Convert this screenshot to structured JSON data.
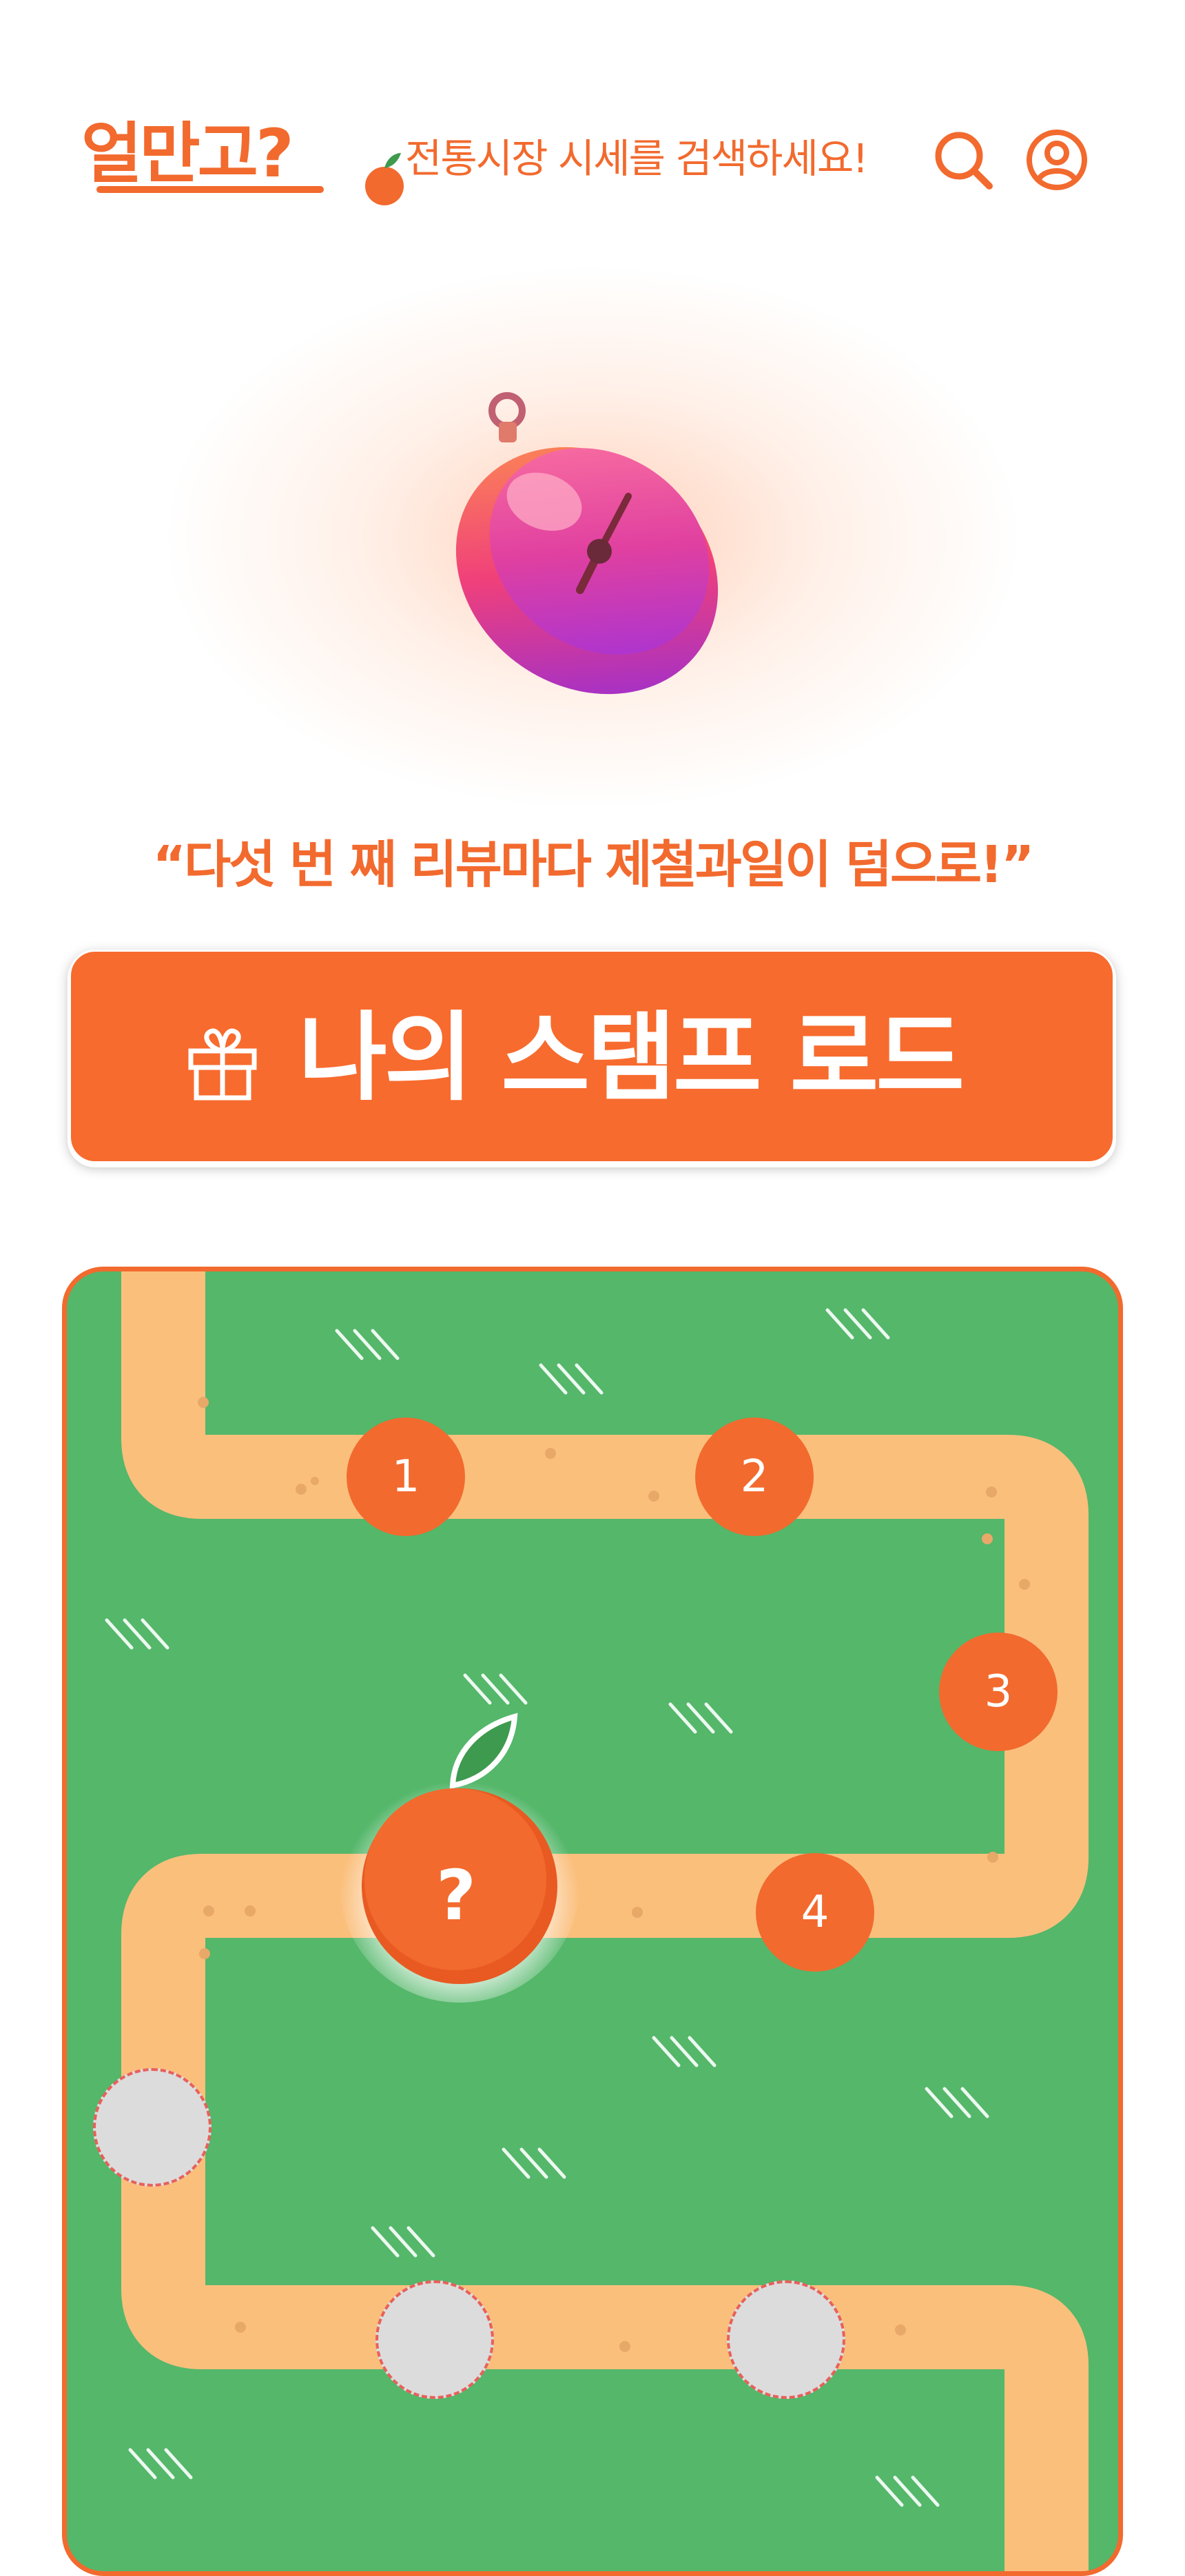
{
  "header": {
    "logo_text": "얼만고?",
    "tagline": "전통시장 시세를 검색하세요!",
    "search_icon": "search-icon",
    "profile_icon": "user-circle-icon"
  },
  "hero": {
    "illustration": "stopwatch-icon",
    "quote": "“다섯 번 째 리뷰마다 제철과일이 덤으로!”"
  },
  "cta": {
    "icon": "gift-icon",
    "label": "나의 스탬프 로드"
  },
  "stamp_road": {
    "stamps": [
      {
        "label": "1",
        "state": "done"
      },
      {
        "label": "2",
        "state": "done"
      },
      {
        "label": "3",
        "state": "done"
      },
      {
        "label": "4",
        "state": "done"
      },
      {
        "label": "?",
        "state": "reward"
      },
      {
        "label": "",
        "state": "locked"
      },
      {
        "label": "",
        "state": "locked"
      },
      {
        "label": "",
        "state": "locked"
      }
    ]
  },
  "colors": {
    "brand_orange": "#F26A2E",
    "grass_green": "#54B76A",
    "path_sand": "#FBBF7C",
    "locked_gray": "#DCDCDC"
  }
}
